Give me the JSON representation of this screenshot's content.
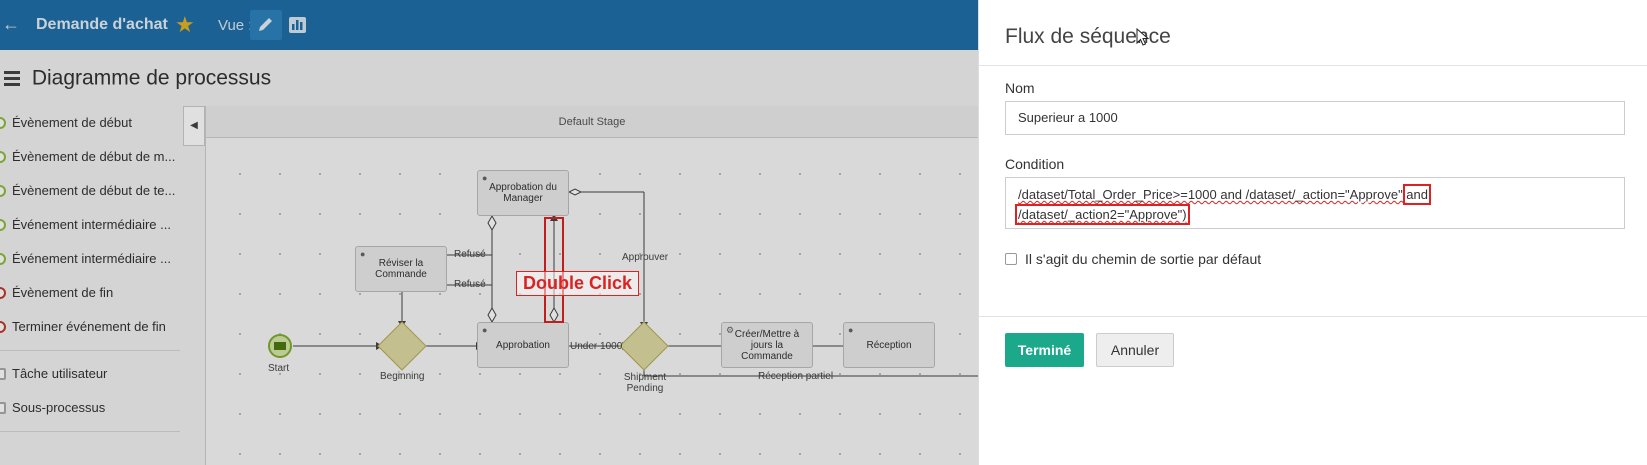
{
  "topbar": {
    "title": "Demande d'achat",
    "view_label": "Vue :",
    "accent": "#1f6fa8"
  },
  "page": {
    "title": "Diagramme de processus"
  },
  "palette": {
    "items": [
      {
        "label": "Évènement de début"
      },
      {
        "label": "Évènement de début de m..."
      },
      {
        "label": "Évènement de début de te..."
      },
      {
        "label": "Événement intermédiaire ..."
      },
      {
        "label": "Événement intermédiaire ..."
      },
      {
        "label": "Évènement de fin"
      },
      {
        "label": "Terminer événement de fin"
      }
    ],
    "items2": [
      {
        "label": "Tâche utilisateur"
      },
      {
        "label": "Sous-processus"
      }
    ]
  },
  "diagram": {
    "stage_label": "Default Stage",
    "nodes": {
      "manager": "Approbation du Manager",
      "reviser": "Réviser la Commande",
      "approbation": "Approbation",
      "creer": "Créer/Mettre à jours la Commande",
      "reception": "Réception",
      "start": "Start",
      "beginning": "Beginning",
      "shipment": "Shipment Pending"
    },
    "edges": {
      "refuse1": "Refusé",
      "refuse2": "Refusé",
      "approuver": "Approuver",
      "under1000": "Under 1000",
      "reception_partiel": "Réception partiel"
    },
    "annotation": "Double Click"
  },
  "panel": {
    "title": "Flux de séquence",
    "name_label": "Nom",
    "name_value": "Superieur a 1000",
    "condition_label": "Condition",
    "condition": {
      "p1": "/dataset/Total_Order_Price>=1000 and /dataset/_action=\"Approve\" ",
      "p2": "and",
      "p3": "/dataset/_action2=\"Approve\")"
    },
    "default_path_label": "Il s'agit du chemin de sortie par défaut",
    "ok_label": "Terminé",
    "cancel_label": "Annuler",
    "ok_color": "#1ba88b"
  }
}
